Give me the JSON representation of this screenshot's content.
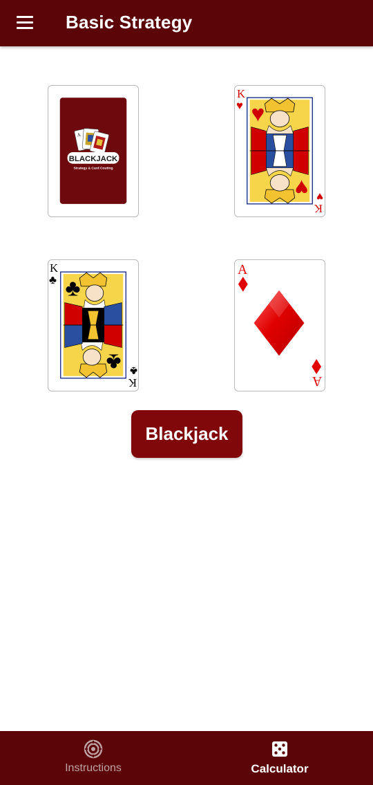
{
  "app_bar": {
    "title": "Basic Strategy",
    "menu_icon": "hamburger-menu-icon"
  },
  "cards": [
    {
      "kind": "back",
      "logo_text": "BLACKJACK",
      "logo_subtitle": "Strategy & Card Couting",
      "back_color": "#6e0a0e"
    },
    {
      "kind": "face",
      "rank": "K",
      "suit": "hearts",
      "suit_symbol": "♥",
      "color": "#d10000"
    },
    {
      "kind": "face",
      "rank": "K",
      "suit": "clubs",
      "suit_symbol": "♣",
      "color": "#000000"
    },
    {
      "kind": "ace",
      "rank": "A",
      "suit": "diamonds",
      "suit_symbol": "♦",
      "color": "#e00000"
    }
  ],
  "action_button": {
    "label": "Blackjack"
  },
  "bottom_nav": {
    "items": [
      {
        "label": "Instructions",
        "icon": "target-icon",
        "active": false
      },
      {
        "label": "Calculator",
        "icon": "dice-icon",
        "active": true
      }
    ]
  },
  "colors": {
    "primary_dark": "#5c0508",
    "button": "#80080a",
    "heart_red": "#d10000",
    "diamond_red": "#e00000"
  }
}
